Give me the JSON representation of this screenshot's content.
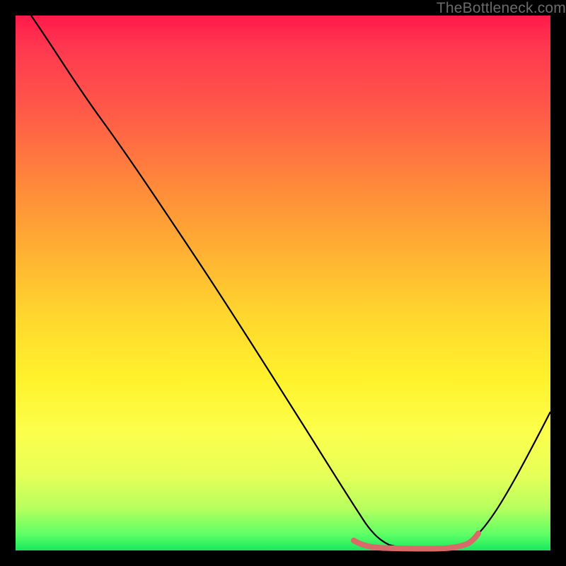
{
  "watermark": "TheBottleneck.com",
  "chart_data": {
    "type": "line",
    "title": "",
    "xlabel": "",
    "ylabel": "",
    "xlim": [
      0,
      100
    ],
    "ylim": [
      0,
      100
    ],
    "x": [
      3,
      8,
      14,
      20,
      26,
      32,
      38,
      44,
      50,
      56,
      60,
      63,
      65,
      68,
      71,
      74,
      77,
      80,
      83,
      85,
      88,
      92,
      96,
      100
    ],
    "values": [
      100,
      93,
      85,
      77.5,
      69,
      60.5,
      52,
      43.5,
      34.5,
      25.5,
      19,
      13.5,
      10,
      6,
      3.2,
      1.8,
      1.3,
      1.3,
      1.6,
      2.4,
      5.5,
      11,
      18,
      26
    ],
    "marker_region": {
      "x_start": 63,
      "x_end": 85,
      "color": "#d96a6a"
    },
    "curve_color": "#000000",
    "background_gradient": [
      "#ff1a4a",
      "#18e85f"
    ]
  }
}
